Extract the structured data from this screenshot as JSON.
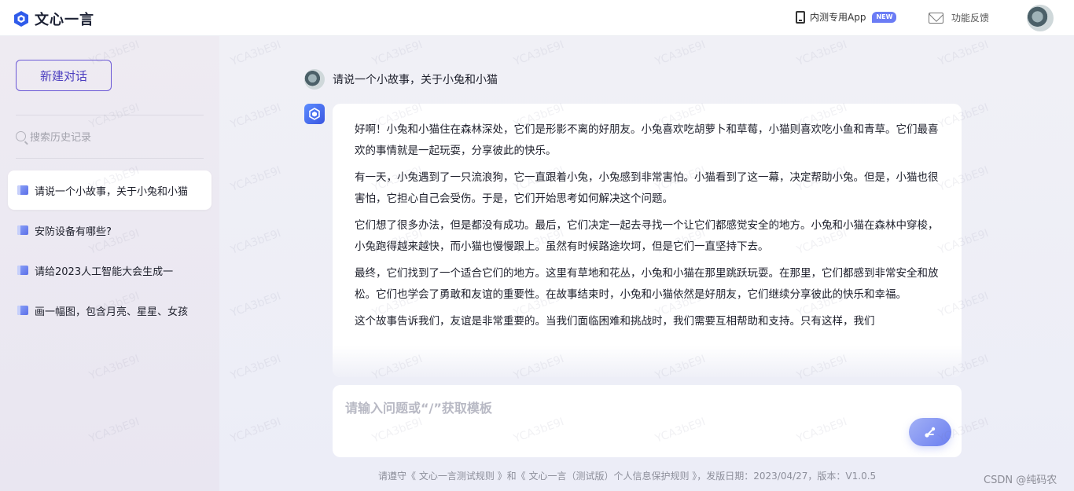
{
  "app": {
    "title": "文心一言"
  },
  "topbar": {
    "app_link_label": "内测专用App",
    "new_badge": "NEW",
    "feedback_label": "功能反馈"
  },
  "sidebar": {
    "new_chat_label": "新建对话",
    "search_placeholder": "搜索历史记录",
    "history": [
      {
        "label": "请说一个小故事，关于小兔和小猫",
        "active": true
      },
      {
        "label": "安防设备有哪些?",
        "active": false
      },
      {
        "label": "请给2023人工智能大会生成一",
        "active": false
      },
      {
        "label": "画一幅图，包含月亮、星星、女孩",
        "active": false
      }
    ]
  },
  "chat": {
    "user_message": "请说一个小故事，关于小兔和小猫",
    "bot_paragraphs": [
      "好啊！小兔和小猫住在森林深处，它们是形影不离的好朋友。小兔喜欢吃胡萝卜和草莓，小猫则喜欢吃小鱼和青草。它们最喜欢的事情就是一起玩耍，分享彼此的快乐。",
      "有一天，小兔遇到了一只流浪狗，它一直跟着小兔，小兔感到非常害怕。小猫看到了这一幕，决定帮助小兔。但是，小猫也很害怕，它担心自己会受伤。于是，它们开始思考如何解决这个问题。",
      "它们想了很多办法，但是都没有成功。最后，它们决定一起去寻找一个让它们都感觉安全的地方。小兔和小猫在森林中穿梭，小兔跑得越来越快，而小猫也慢慢跟上。虽然有时候路途坎坷，但是它们一直坚持下去。",
      "最终，它们找到了一个适合它们的地方。这里有草地和花丛，小兔和小猫在那里跳跃玩耍。在那里，它们都感到非常安全和放松。它们也学会了勇敢和友谊的重要性。在故事结束时，小兔和小猫依然是好朋友，它们继续分享彼此的快乐和幸福。",
      "这个故事告诉我们，友谊是非常重要的。当我们面临困难和挑战时，我们需要互相帮助和支持。只有这样，我们"
    ],
    "input_placeholder": "请输入问题或“/”获取模板"
  },
  "footer": {
    "text": "请遵守《 文心一言测试规则 》和《 文心一言（测试版）个人信息保护规则 》，发版日期：2023/04/27，版本：V1.0.5"
  },
  "watermark": "YCA3bE9I",
  "corner_credit": "CSDN @纯码农",
  "colors": {
    "accent": "#4d3fc0",
    "brand_blue": "#3a56e0",
    "badge": "#6b7cf5"
  }
}
